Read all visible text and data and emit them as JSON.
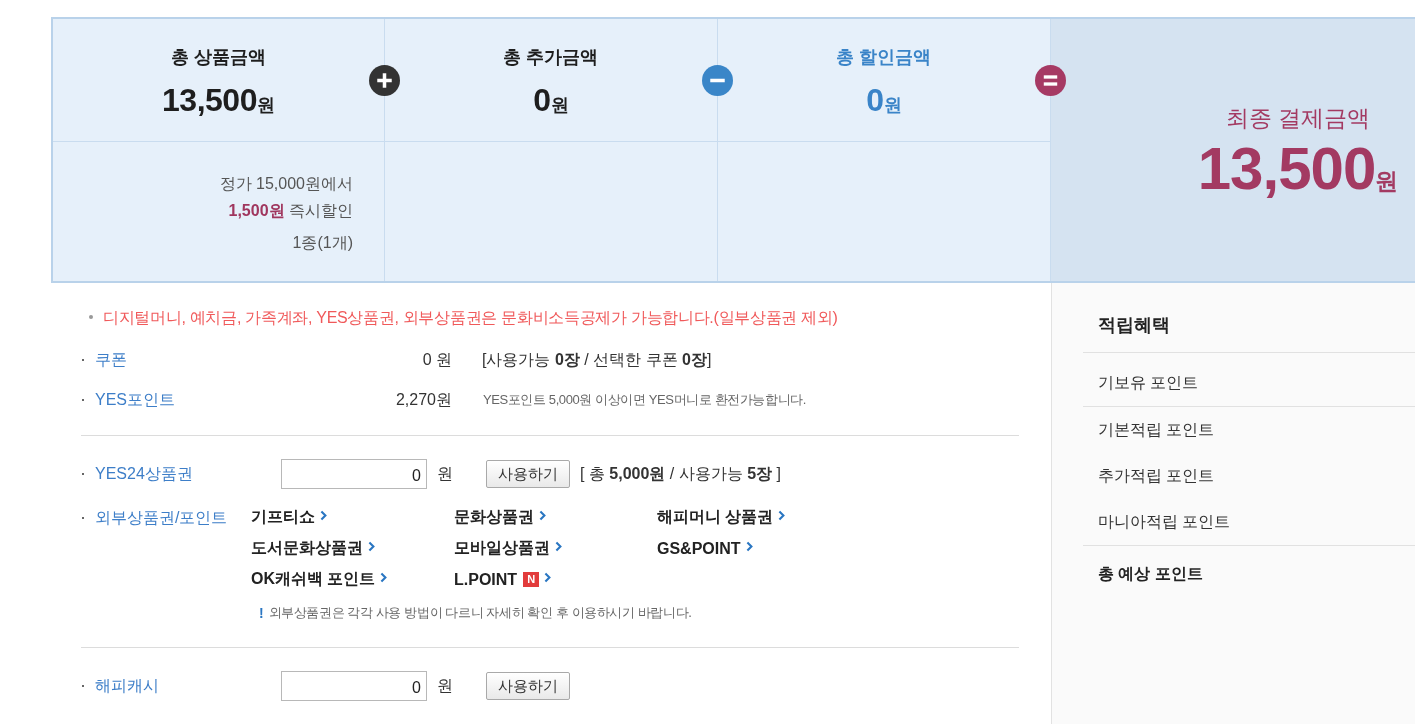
{
  "summary": {
    "columns": [
      {
        "kind": "normal",
        "title": "총 상품금액",
        "amount": "13,500",
        "unit": "원",
        "details": [
          "정가 15,000원에서",
          "**1,500원** 즉시할인",
          "1종(1개)"
        ],
        "operator": {
          "kind": "plus"
        }
      },
      {
        "kind": "normal",
        "title": "총 추가금액",
        "amount": "0",
        "unit": "원",
        "operator": {
          "kind": "minus"
        }
      },
      {
        "kind": "discount",
        "title": "총 할인금액",
        "amount": "0",
        "unit": "원",
        "operator": {
          "kind": "equals"
        }
      }
    ],
    "final": {
      "title": "최종 결제금액",
      "amount": "13,500",
      "unit": "원"
    }
  },
  "notice": "디지털머니, 예치금, 가족계좌, YES상품권, 외부상품권은 문화비소득공제가 가능합니다.(일부상품권 제외)",
  "payment_sections": [
    {
      "rows": [
        {
          "kind": "info",
          "label": "쿠폰",
          "value": "0 원",
          "info": "[사용가능 **0장** / 선택한 쿠폰 **0장**]"
        },
        {
          "kind": "note",
          "label": "YES포인트",
          "value": "2,270원",
          "info": "YES포인트 5,000원 이상이면 YES머니로 환전가능합니다."
        }
      ]
    },
    {
      "rows": [
        {
          "kind": "input",
          "label": "YES24상품권",
          "value": "0",
          "unit": "원",
          "button": "사용하기",
          "info": "[ 총 **5,000원** / 사용가능 **5장** ]"
        },
        {
          "kind": "links",
          "label": "외부상품권/포인트",
          "links": [
            {
              "label": "기프티쇼"
            },
            {
              "label": "문화상품권"
            },
            {
              "label": "해피머니 상품권"
            },
            {
              "label": "도서문화상품권"
            },
            {
              "label": "모바일상품권"
            },
            {
              "label": "GS&POINT"
            },
            {
              "label": "OK캐쉬백 포인트"
            },
            {
              "label": "L.POINT",
              "badge": "N"
            }
          ],
          "note_mark": "!",
          "note": "외부상품권은 각각 사용 방법이 다르니 자세히 확인 후 이용하시기 바랍니다."
        }
      ]
    },
    {
      "rows": [
        {
          "kind": "input",
          "label": "해피캐시",
          "value": "0",
          "unit": "원",
          "button": "사용하기"
        }
      ]
    }
  ],
  "rewards": {
    "title": "적립혜택",
    "groups": [
      {
        "items": [
          "기보유 포인트"
        ]
      },
      {
        "items": [
          "기본적립 포인트",
          "추가적립 포인트",
          "마니아적립 포인트"
        ]
      }
    ],
    "total": "총 예상 포인트"
  }
}
